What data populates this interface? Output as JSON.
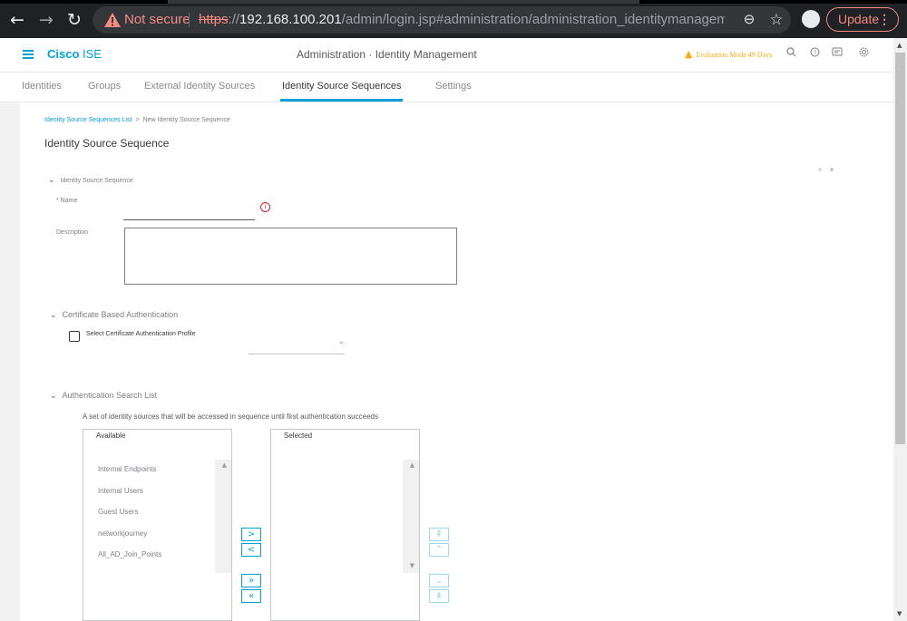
{
  "browser": {
    "security_label": "Not secure",
    "url_scheme": "https",
    "url_sep": "://",
    "url_host": "192.168.100.201",
    "url_path": "/admin/login.jsp#administration/administration_identitymanagement/a...",
    "update_label": "Update",
    "update_menu": "⋮",
    "back_icon": "←",
    "forward_icon": "→",
    "reload_icon": "↻",
    "zoom_icon": "⊖",
    "bookmark_icon": "☆"
  },
  "header": {
    "logo_bold": "Cisco",
    "logo_rest": " ISE",
    "page_heading": "Administration · Identity Management",
    "evaluation": "Evaluation Mode 49 Days",
    "eval_icon": "▲",
    "icons": [
      "search-icon",
      "help-icon",
      "notification-icon",
      "gear-icon"
    ],
    "accent_color": "#049fd9",
    "warning_color": "#fbab18"
  },
  "tabs": [
    {
      "label": "Identities",
      "active": false
    },
    {
      "label": "Groups",
      "active": false
    },
    {
      "label": "External Identity Sources",
      "active": false
    },
    {
      "label": "Identity Source Sequences",
      "active": true
    },
    {
      "label": "Settings",
      "active": false
    }
  ],
  "breadcrumb": {
    "link": "Identity Source Sequences List",
    "separator": ">",
    "current": "New Identity Source Sequence"
  },
  "page_title": "Identity Source Sequence",
  "form": {
    "section_iss": "Identity Source Sequence",
    "name_label": "* Name",
    "name_value": "",
    "name_info": "i",
    "description_label": "Description",
    "description_value": "",
    "section_cba": "Certificate Based Authentication",
    "cba_checkbox_label": "Select Certificate Authentication Profile",
    "cba_checked": false,
    "cba_selected": "",
    "section_asl": "Authentication Search List",
    "asl_description": "A set of identity sources that will be accessed in sequence until first authentication succeeds",
    "available_header": "Available",
    "selected_header": "Selected",
    "available_items": [
      "Internal Endpoints",
      "Internal Users",
      "Guest Users",
      "networkjourney",
      "All_AD_Join_Points"
    ],
    "selected_items": []
  },
  "buttons": {
    "move_right": ">",
    "move_left": "<",
    "move_all_right": "»",
    "move_all_left": "«",
    "move_top": "⇞",
    "move_up": "⌃",
    "move_down": "⌄",
    "move_bottom": "⇟"
  }
}
